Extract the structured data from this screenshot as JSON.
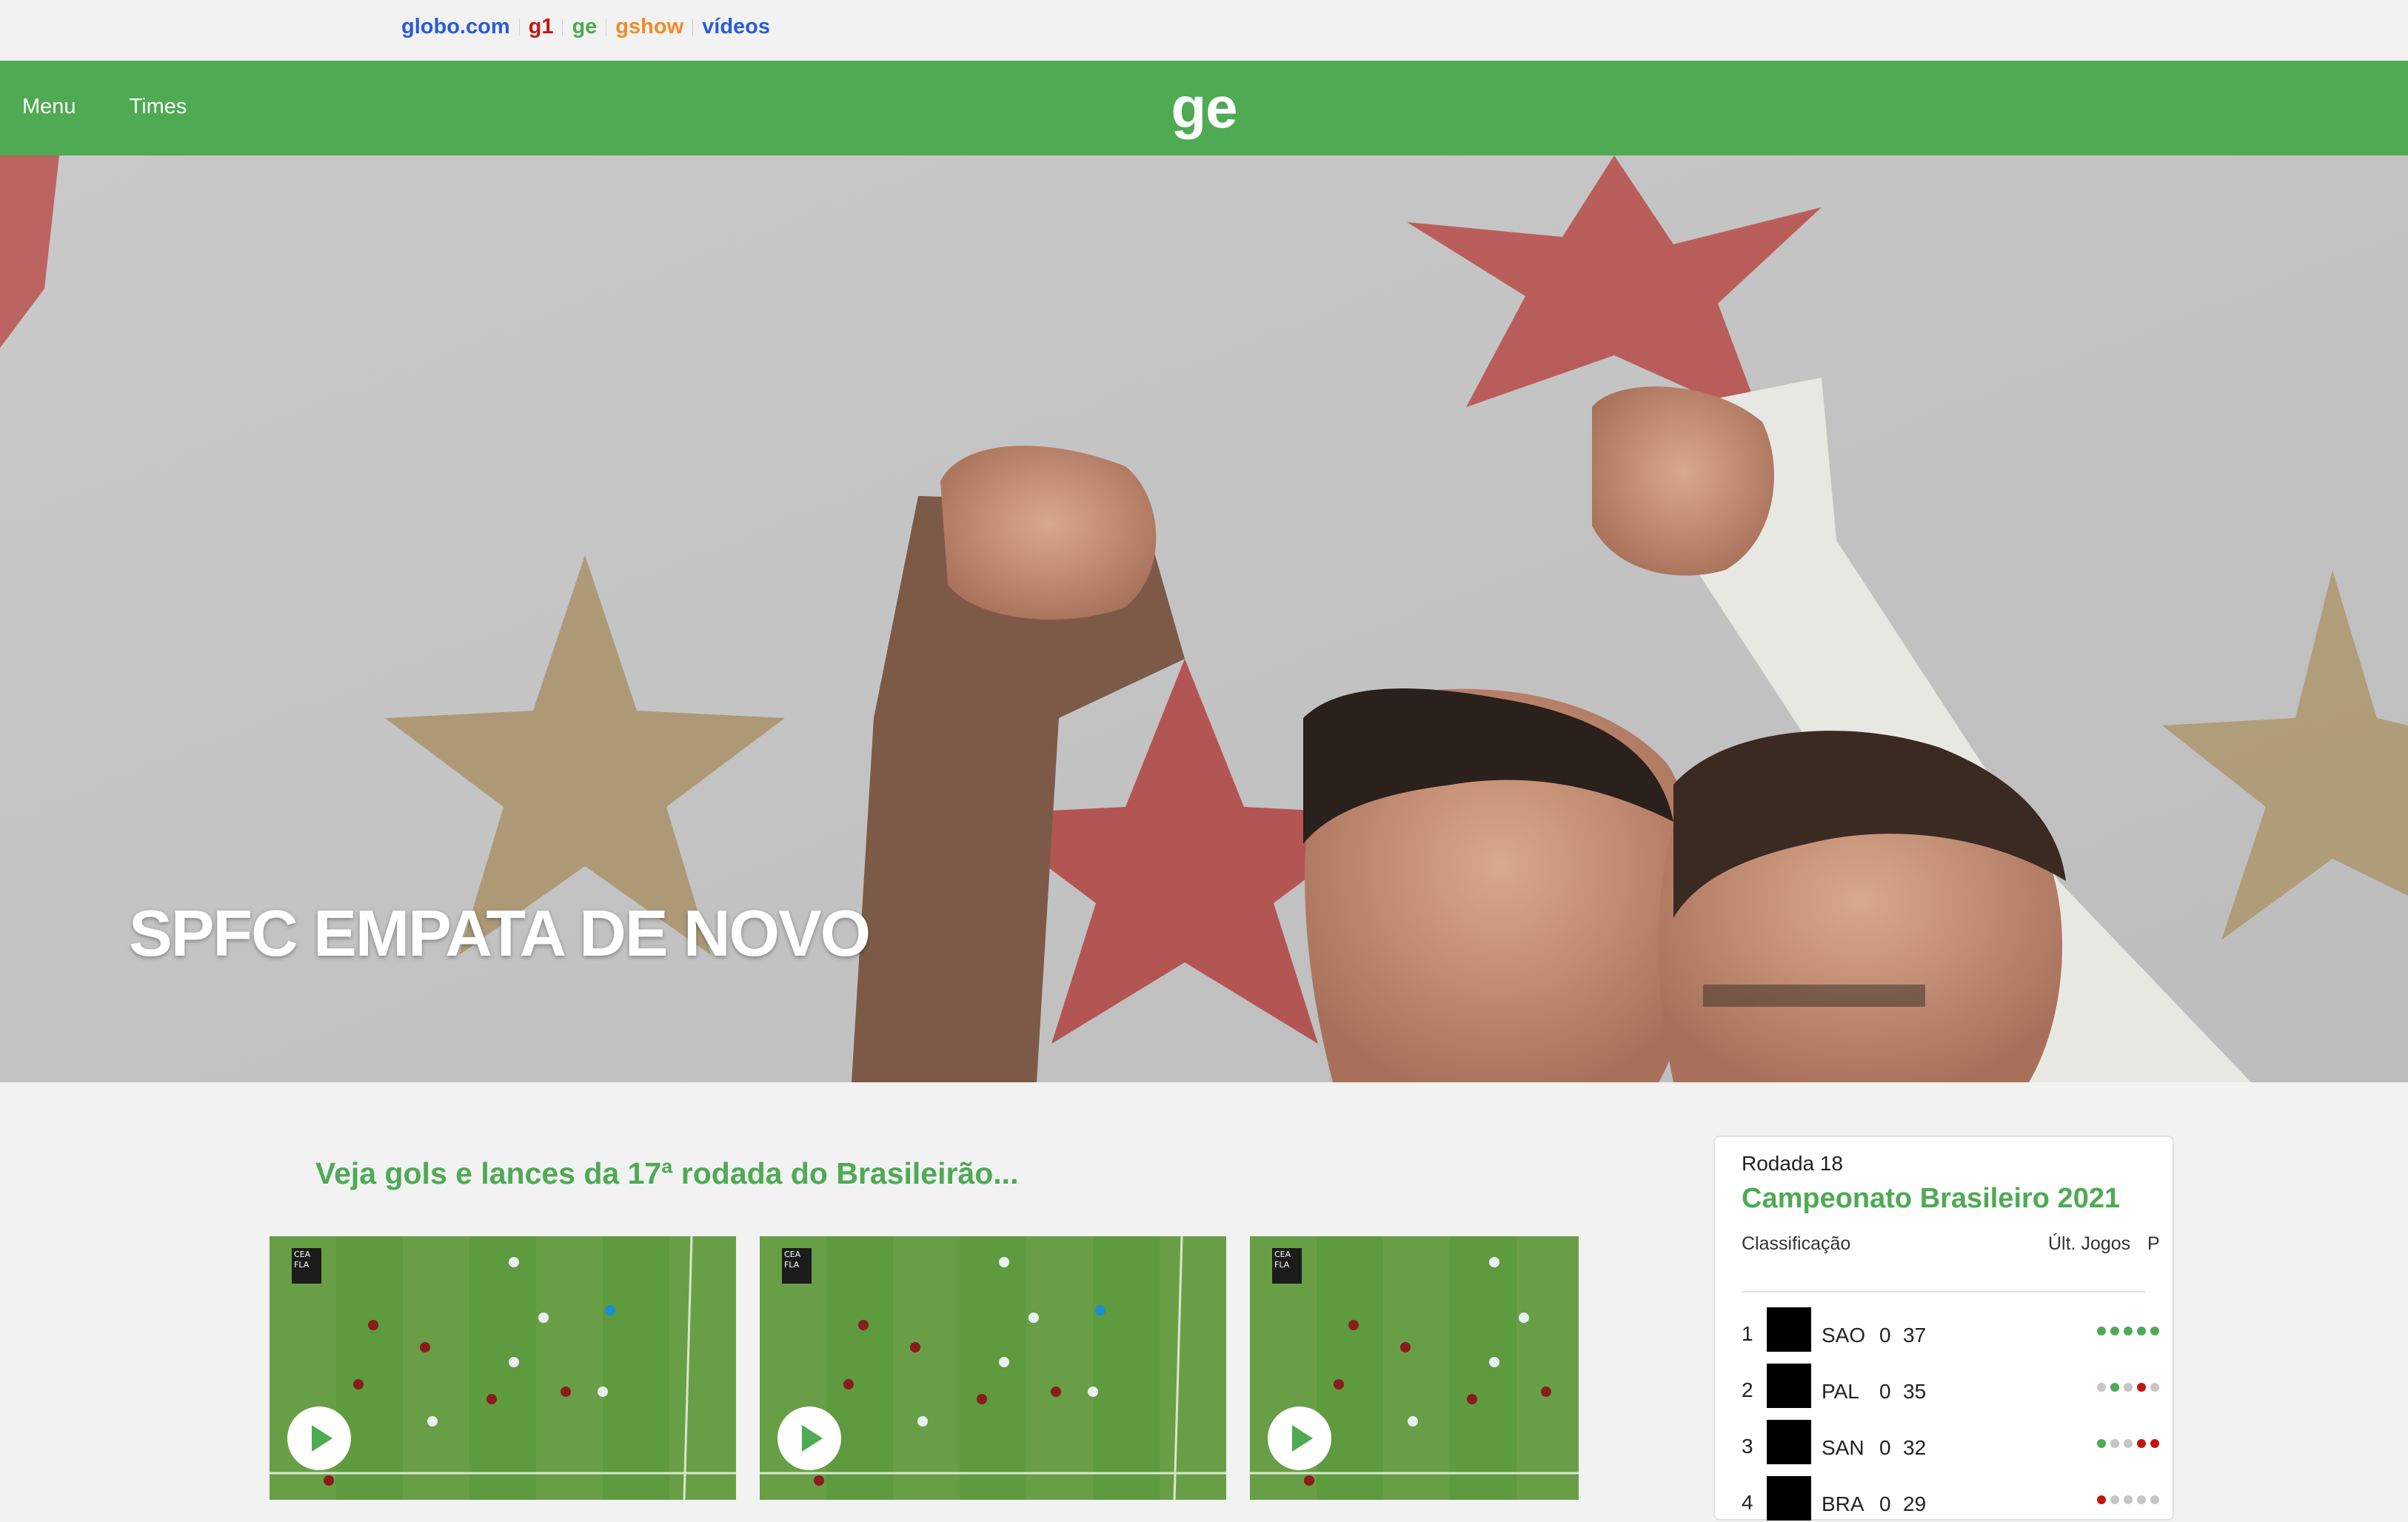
{
  "global_nav": [
    {
      "label": "globo.com",
      "color": "#2a5bd7"
    },
    {
      "label": "g1",
      "color": "#c4170c"
    },
    {
      "label": "ge",
      "color": "#4eaa53"
    },
    {
      "label": "gshow",
      "color": "#f08c28"
    },
    {
      "label": "vídeos",
      "color": "#2a5bd7"
    }
  ],
  "header": {
    "menu_label": "Menu",
    "times_label": "Times",
    "logo": "ge",
    "brand_color": "#4eaa53"
  },
  "hero": {
    "headline": "SPFC EMPATA DE NOVO"
  },
  "videos": {
    "section_title": "Veja gols e lances da 17ª rodada do Brasileirão...",
    "thumb_overlay": [
      "CEA",
      "FLA"
    ],
    "play_icon": "play-icon"
  },
  "standings": {
    "round": "Rodada 18",
    "championship": "Campeonato Brasileiro 2021",
    "col_classification": "Classificação",
    "col_last_games": "Últ. Jogos",
    "col_points": "P",
    "rows": [
      {
        "pos": "1",
        "team": "SAO",
        "games": "0",
        "points": "37",
        "last": [
          "W",
          "W",
          "W",
          "W",
          "W"
        ]
      },
      {
        "pos": "2",
        "team": "PAL",
        "games": "0",
        "points": "35",
        "last": [
          "D",
          "W",
          "D",
          "L",
          "D"
        ]
      },
      {
        "pos": "3",
        "team": "SAN",
        "games": "0",
        "points": "32",
        "last": [
          "W",
          "D",
          "D",
          "L",
          "L"
        ]
      },
      {
        "pos": "4",
        "team": "BRA",
        "games": "0",
        "points": "29",
        "last": [
          "L",
          "D",
          "D",
          "D",
          "D"
        ]
      }
    ],
    "result_colors": {
      "W": "#4eaa53",
      "D": "#c6c6c6",
      "L": "#c4170c"
    }
  }
}
